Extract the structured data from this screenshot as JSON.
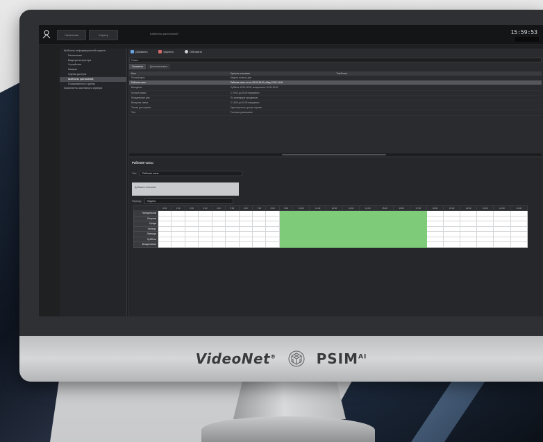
{
  "app": {
    "window_title": "Шаблоны расписаний",
    "top_buttons": [
      "Начальная",
      "Сервер"
    ],
    "clock": "15:59:53"
  },
  "branding": {
    "videonet": "VideoNet",
    "videonet_mark": "®",
    "psim": "PSIM",
    "psim_suffix": "AI"
  },
  "sidebar": {
    "items": [
      {
        "label": "Шаблоны информационной модели",
        "level": 1,
        "selected": false
      },
      {
        "label": "Расписания",
        "level": 2,
        "selected": false
      },
      {
        "label": "Видеорегистраторы",
        "level": 2,
        "selected": false
      },
      {
        "label": "Устройства",
        "level": 2,
        "selected": false
      },
      {
        "label": "Камеры",
        "level": 2,
        "selected": false
      },
      {
        "label": "Группы доступа",
        "level": 2,
        "selected": false
      },
      {
        "label": "Шаблоны расписаний",
        "level": 2,
        "selected": true
      },
      {
        "label": "Пользователи и группы",
        "level": 2,
        "selected": false
      },
      {
        "label": "Компоненты системного сервера",
        "level": 1,
        "selected": false
      }
    ]
  },
  "toolbar": {
    "add_label": "Добавить",
    "delete_label": "Удалить",
    "refresh_label": "Обновить"
  },
  "search": {
    "value": "Поиск"
  },
  "tabs": [
    {
      "label": "Основное",
      "active": true
    },
    {
      "label": "Дополнительно",
      "active": false
    }
  ],
  "properties": {
    "headers": [
      "Имя",
      "Краткое описание",
      "Тип/Класс"
    ],
    "rows": [
      {
        "name": "Полный день",
        "desc": "Модель полного дня",
        "type": "",
        "selected": false
      },
      {
        "name": "Рабочие часы",
        "desc": "Рабочие часы: пн-пт, 09:00-18:00, обед 13:00-14:00",
        "type": "",
        "selected": true
      },
      {
        "name": "Выходные",
        "desc": "Суббота 10:00-16:00, воскресенье 10:00-16:00",
        "type": "",
        "selected": false
      },
      {
        "name": "Ночной режим",
        "desc": "С 20:00 до 08:00 ежедневно",
        "type": "",
        "selected": false
      },
      {
        "name": "Праздничные дни",
        "desc": "По календарю праздников",
        "type": "",
        "selected": false
      },
      {
        "name": "Вечерняя смена",
        "desc": "С 16:00 до 00:00 ежедневно",
        "type": "",
        "selected": false
      },
      {
        "name": "Только для охраны",
        "desc": "Круглосуточно, доступ охраны",
        "type": "",
        "selected": false
      },
      {
        "name": "Тест",
        "desc": "Тестовое расписание",
        "type": "",
        "selected": false
      }
    ]
  },
  "detail": {
    "title": "Рабочие часы",
    "type_label": "Тип:",
    "type_value": "Рабочие часы",
    "note": "Добавьте описание",
    "period_label": "Период:",
    "period_value": "Неделя",
    "hours": [
      "0:00",
      "1:00",
      "2:00",
      "3:00",
      "4:00",
      "5:00",
      "6:00",
      "7:00",
      "8:00",
      "9:00",
      "10:00",
      "11:00",
      "12:00",
      "13:00",
      "14:00",
      "15:00",
      "16:00",
      "17:00",
      "18:00",
      "19:00",
      "20:00",
      "21:00",
      "22:00",
      "23:00"
    ],
    "days": [
      "Понедельник",
      "Вторник",
      "Среда",
      "Четверг",
      "Пятница",
      "Суббота",
      "Воскресенье"
    ],
    "active_hours": {
      "start": 9,
      "end": 18
    }
  },
  "colors": {
    "schedule_on": "#7ecb79",
    "schedule_off": "#ffffff"
  }
}
